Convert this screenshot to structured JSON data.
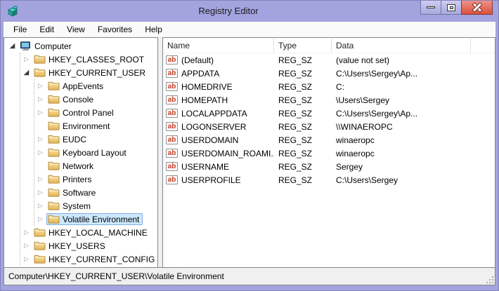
{
  "window": {
    "title": "Registry Editor",
    "controls": {
      "minimize": "Minimize",
      "maximize": "Maximize",
      "close": "Close"
    }
  },
  "menu": {
    "items": [
      "File",
      "Edit",
      "View",
      "Favorites",
      "Help"
    ]
  },
  "tree": {
    "root": {
      "label": "Computer",
      "icon": "computer",
      "state": "expanded",
      "children": [
        {
          "label": "HKEY_CLASSES_ROOT",
          "icon": "folder",
          "state": "collapsed"
        },
        {
          "label": "HKEY_CURRENT_USER",
          "icon": "folder",
          "state": "expanded",
          "children": [
            {
              "label": "AppEvents",
              "icon": "folder",
              "state": "collapsed"
            },
            {
              "label": "Console",
              "icon": "folder",
              "state": "collapsed"
            },
            {
              "label": "Control Panel",
              "icon": "folder",
              "state": "collapsed"
            },
            {
              "label": "Environment",
              "icon": "folder",
              "state": "leaf"
            },
            {
              "label": "EUDC",
              "icon": "folder",
              "state": "collapsed"
            },
            {
              "label": "Keyboard Layout",
              "icon": "folder",
              "state": "collapsed"
            },
            {
              "label": "Network",
              "icon": "folder",
              "state": "leaf"
            },
            {
              "label": "Printers",
              "icon": "folder",
              "state": "collapsed"
            },
            {
              "label": "Software",
              "icon": "folder",
              "state": "collapsed"
            },
            {
              "label": "System",
              "icon": "folder",
              "state": "collapsed"
            },
            {
              "label": "Volatile Environment",
              "icon": "folder",
              "state": "collapsed",
              "selected": true
            }
          ]
        },
        {
          "label": "HKEY_LOCAL_MACHINE",
          "icon": "folder",
          "state": "collapsed"
        },
        {
          "label": "HKEY_USERS",
          "icon": "folder",
          "state": "collapsed"
        },
        {
          "label": "HKEY_CURRENT_CONFIG",
          "icon": "folder",
          "state": "collapsed"
        }
      ]
    }
  },
  "list": {
    "columns": [
      "Name",
      "Type",
      "Data"
    ],
    "value_icon": "string-value-ab-icon",
    "rows": [
      {
        "name": "(Default)",
        "type": "REG_SZ",
        "data": "(value not set)"
      },
      {
        "name": "APPDATA",
        "type": "REG_SZ",
        "data": "C:\\Users\\Sergey\\Ap..."
      },
      {
        "name": "HOMEDRIVE",
        "type": "REG_SZ",
        "data": "C:"
      },
      {
        "name": "HOMEPATH",
        "type": "REG_SZ",
        "data": "\\Users\\Sergey"
      },
      {
        "name": "LOCALAPPDATA",
        "type": "REG_SZ",
        "data": "C:\\Users\\Sergey\\Ap..."
      },
      {
        "name": "LOGONSERVER",
        "type": "REG_SZ",
        "data": "\\\\WINAEROPC"
      },
      {
        "name": "USERDOMAIN",
        "type": "REG_SZ",
        "data": "winaeropc"
      },
      {
        "name": "USERDOMAIN_ROAMI...",
        "type": "REG_SZ",
        "data": "winaeropc"
      },
      {
        "name": "USERNAME",
        "type": "REG_SZ",
        "data": "Sergey"
      },
      {
        "name": "USERPROFILE",
        "type": "REG_SZ",
        "data": "C:\\Users\\Sergey"
      }
    ]
  },
  "status": {
    "path": "Computer\\HKEY_CURRENT_USER\\Volatile Environment"
  },
  "colors": {
    "chrome": "#a3a3e0",
    "close_button": "#d9503f",
    "selection_bg": "#cce8ff",
    "selection_border": "#84acdd",
    "value_icon_text": "#c23b22",
    "folder": "#ecc05e"
  }
}
